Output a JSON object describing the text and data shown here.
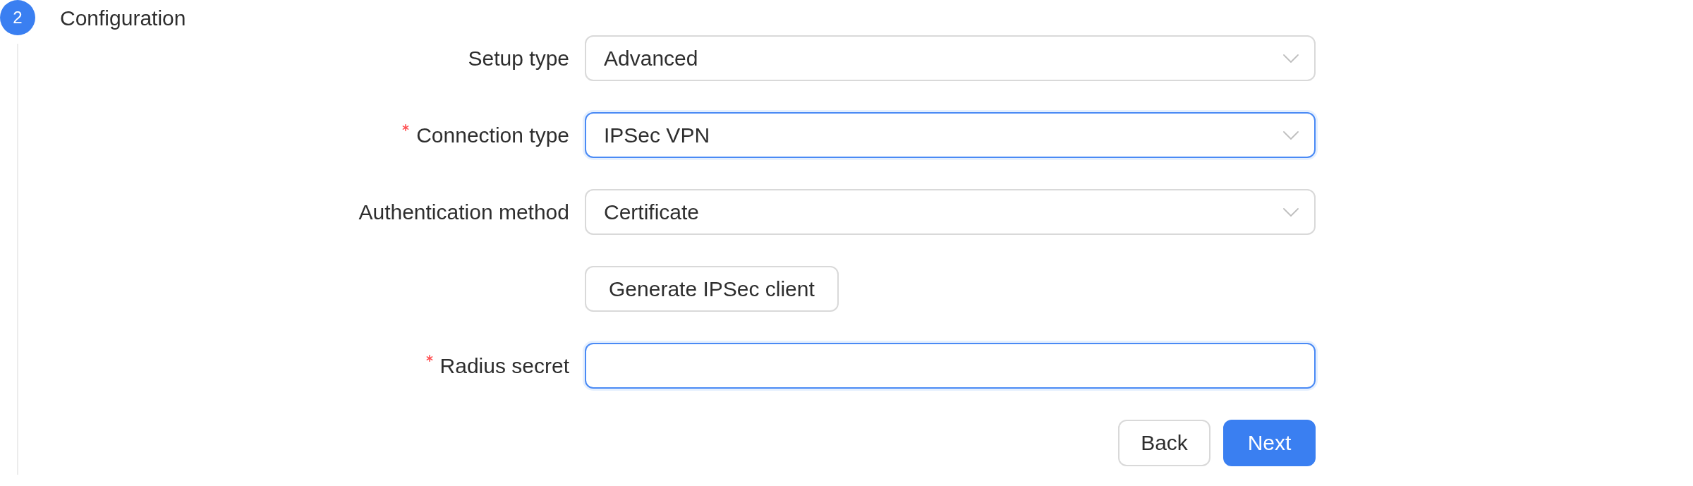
{
  "step": {
    "number": "2",
    "title": "Configuration",
    "active": true
  },
  "fields": [
    {
      "kind": "select",
      "label": "Setup type",
      "required": false,
      "value": "Advanced",
      "focused": false
    },
    {
      "kind": "select",
      "label": "Connection type",
      "required": true,
      "value": "IPSec VPN",
      "focused": true
    },
    {
      "kind": "select",
      "label": "Authentication method",
      "required": false,
      "value": "Certificate",
      "focused": false
    },
    {
      "kind": "button",
      "text": "Generate IPSec client"
    },
    {
      "kind": "input",
      "label": "Radius secret",
      "required": true,
      "focused": true
    }
  ],
  "actions": [
    {
      "label": "Back",
      "primary": false
    },
    {
      "label": "Next",
      "primary": true
    }
  ]
}
